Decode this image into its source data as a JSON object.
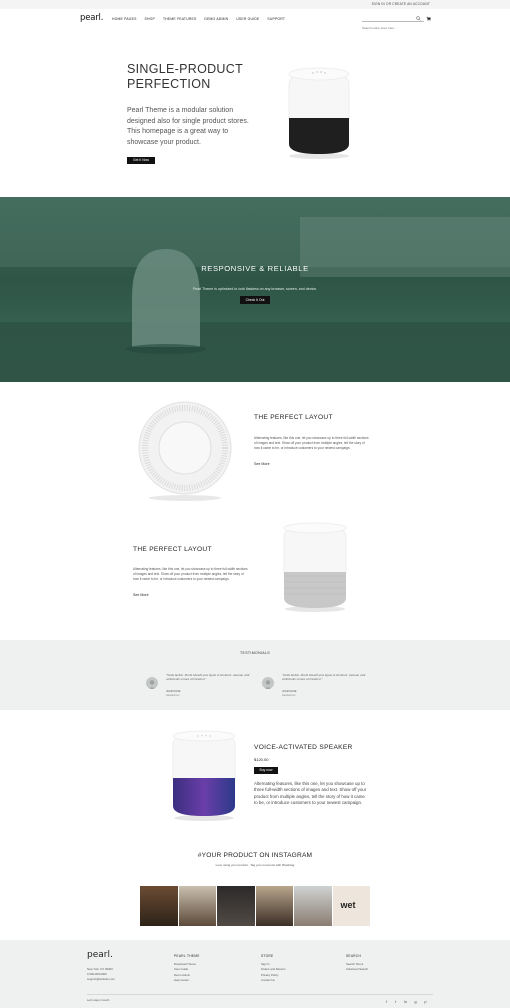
{
  "topbar": {
    "links": "SIGN IN OR CREATE AN ACCOUNT"
  },
  "header": {
    "logo": "pearl.",
    "nav": [
      "HOME PAGES",
      "SHOP",
      "THEME FEATURES",
      "DEMO ADMIN",
      "USER GUIDE",
      "SUPPORT"
    ],
    "search_placeholder": "Search entire store here..."
  },
  "hero": {
    "title": "SINGLE-PRODUCT PERFECTION",
    "text": "Pearl Theme is a modular solution designed also for single product stores. This homepage is a great way to showcase your product.",
    "button": "Get It Now"
  },
  "banner": {
    "title": "RESPONSIVE & RELIABLE",
    "text": "Pearl Theme is optimized to look flawless on any browser, screen, and device.",
    "button": "Check It Out"
  },
  "feature1": {
    "title": "THE PERFECT LAYOUT",
    "text": "Alternating features, like this one, let you showcase up to three full-width sections of images and text. Show off your product from multiple angles, tell the story of how it came to be, or introduce customers to your newest campaign.",
    "link": "See More"
  },
  "feature2": {
    "title": "THE PERFECT LAYOUT",
    "text": "Alternating features, like this one, let you showcase up to three full-width sections of images and text. Show off your product from multiple angles, tell the story of how it came to be, or introduce customers to your newest campaign.",
    "link": "See More"
  },
  "testimonials": {
    "title": "TESTIMONIALS",
    "items": [
      {
        "quote": "\"Nulla facilisi. Morbi blandit quis ligula ut tincidunt. Aenean velit sollicitudin ornare id tincidunt.\"",
        "name": "JOHN DOE",
        "role": "Hewlettcom"
      },
      {
        "quote": "\"Nulla facilisi. Morbi blandit quis ligula ut tincidunt. Aenean velit sollicitudin ornare id tincidunt.\"",
        "name": "JOHN DOE",
        "role": "Hewlettcom"
      }
    ]
  },
  "product": {
    "title": "VOICE-ACTIVATED SPEAKER",
    "price": "$120.00",
    "button": "Buy now",
    "text": "Alternating features, like this one, let you showcase up to three full-width sections of images and text. Show off your product from multiple angles, tell the story of how it came to be, or introduce customers to your newest campaign."
  },
  "instagram": {
    "title": "#YOUR PRODUCT ON INSTAGRAM",
    "subtitle": "Love using your product - Tag your moments with #hashtag",
    "tile_text": "wet"
  },
  "footer": {
    "logo": "pearl.",
    "contact": [
      "New York, NY 00000",
      "0 000-000-0000",
      "support@website.com"
    ],
    "columns": [
      {
        "title": "PEARL THEME",
        "items": [
          "Download Theme",
          "User Guide",
          "Demo Admin",
          "Help Center"
        ]
      },
      {
        "title": "STORE",
        "items": [
          "Sign In",
          "Orders and Returns",
          "Privacy Policy",
          "Contact Us"
        ]
      },
      {
        "title": "SEARCH",
        "items": [
          "Search Terms",
          "Advanced Search"
        ]
      }
    ],
    "copyright": "Let's stay in touch",
    "social": [
      "f",
      "t",
      "in",
      "g",
      "p"
    ]
  },
  "colors": {
    "banner": "#2e5546",
    "accent": "#111111",
    "light_bg": "#eff1f0"
  }
}
